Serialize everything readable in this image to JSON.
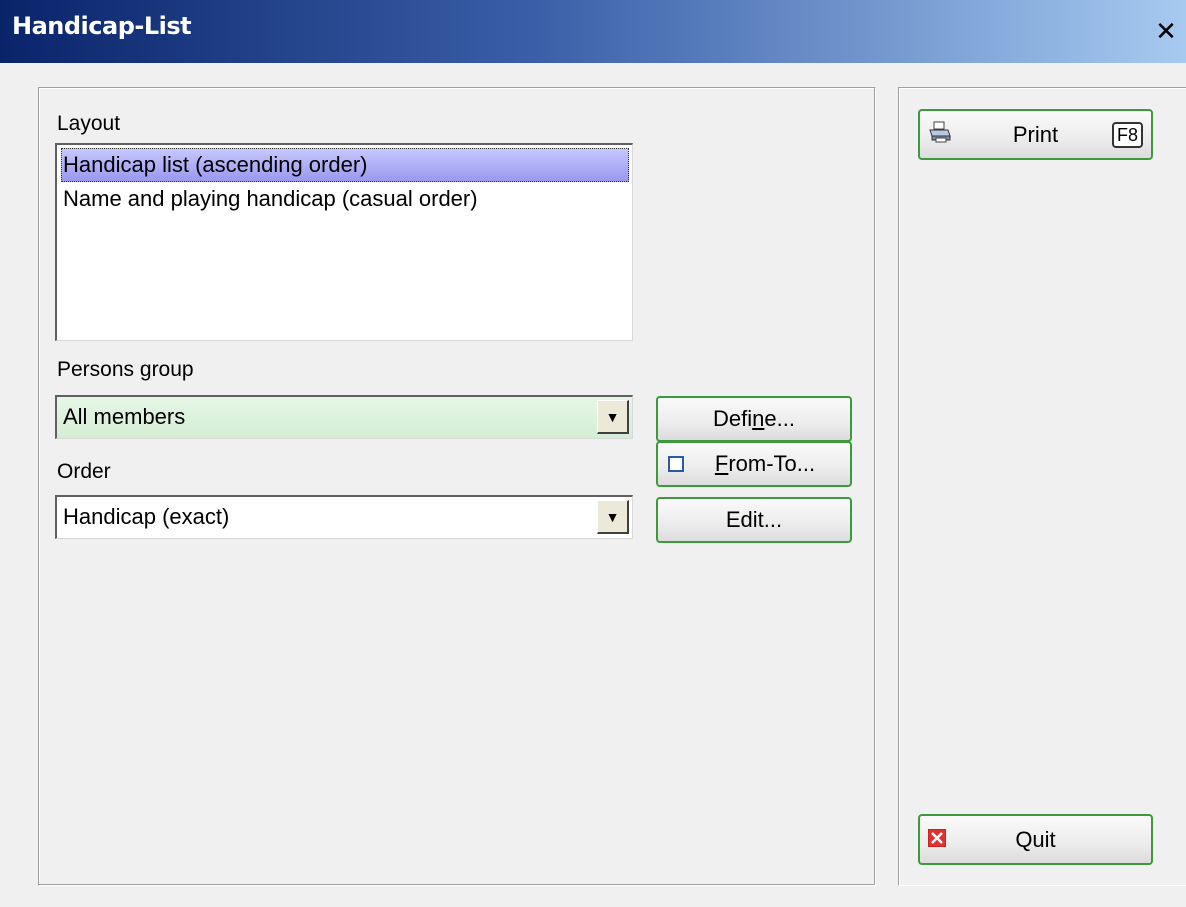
{
  "window": {
    "title": "Handicap-List",
    "close_label": "✕"
  },
  "layout": {
    "label": "Layout",
    "items": [
      "Handicap list (ascending order)",
      "Name and playing handicap (casual order)"
    ],
    "selected_index": 0
  },
  "persons_group": {
    "label_pre": "Persons ",
    "label_acc": "g",
    "label_post": "roup",
    "value": "All members"
  },
  "order": {
    "label": "Order",
    "value": "Handicap (exact)"
  },
  "buttons": {
    "define_pre": "Defi",
    "define_acc": "n",
    "define_post": "e...",
    "fromto_acc": "F",
    "fromto_post": "rom-To...",
    "edit": "Edit...",
    "print": "Print",
    "print_key": "F8",
    "quit": "Quit"
  },
  "colors": {
    "title_gradient_start": "#0a246a",
    "title_gradient_end": "#a6caf0",
    "button_border": "#3c9a3c",
    "combo_highlight": "#d8f0d8",
    "selection": "#9898f0",
    "quit_icon": "#e03030"
  },
  "icons": {
    "print": "printer-icon",
    "quit": "close-x-icon",
    "dropdown": "triangle-down-icon"
  }
}
